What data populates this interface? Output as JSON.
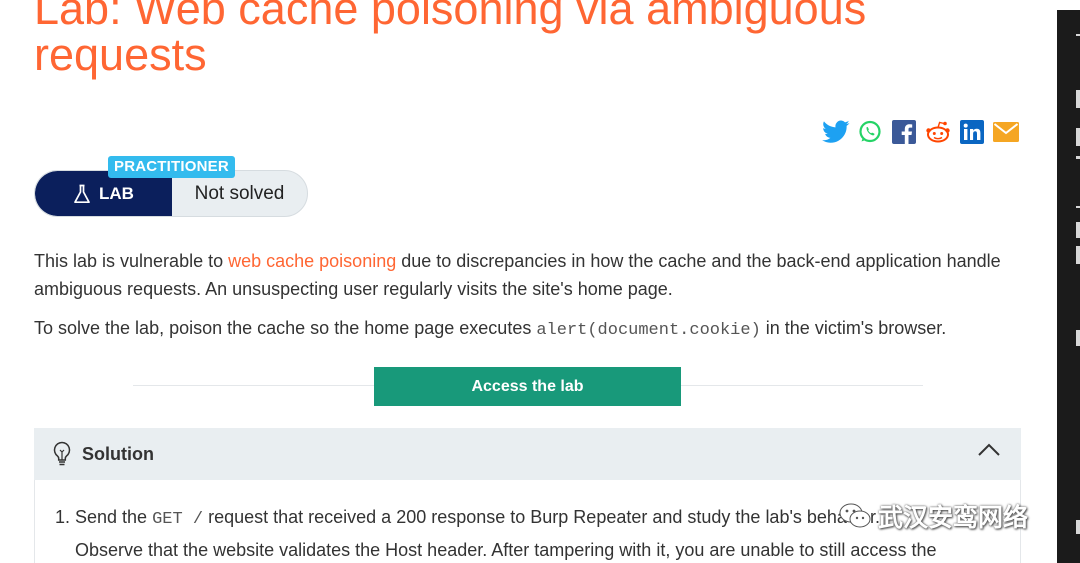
{
  "page": {
    "title_line1": "Lab: Web cache poisoning via ambiguous",
    "title_line2": "requests"
  },
  "share": {
    "icons": [
      "twitter-icon",
      "whatsapp-icon",
      "facebook-icon",
      "reddit-icon",
      "linkedin-icon",
      "email-icon"
    ],
    "colors": {
      "twitter": "#1da1f2",
      "whatsapp": "#25d366",
      "facebook": "#3b5998",
      "reddit": "#ff4500",
      "linkedin": "#0a66c2",
      "email": "#f5a623"
    }
  },
  "badge": {
    "level": "PRACTITIONER",
    "type": "LAB",
    "status": "Not solved"
  },
  "description": {
    "p1_before": "This lab is vulnerable to ",
    "p1_link": "web cache poisoning",
    "p1_after": " due to discrepancies in how the cache and the back-end application handle ambiguous requests. An unsuspecting user regularly visits the site's home page.",
    "p2_before": "To solve the lab, poison the cache so the home page executes ",
    "p2_code": "alert(document.cookie)",
    "p2_after": " in the victim's browser."
  },
  "access_button": "Access the lab",
  "solution": {
    "title": "Solution",
    "step_number": "1.",
    "step_before": "Send the ",
    "step_code": "GET /",
    "step_after": " request that received a 200 response to Burp Repeater and study the lab's behavior.",
    "step_line2": "Observe that the website validates the Host header. After tampering with it, you are unable to still access the"
  },
  "watermark": "武汉安鸾网络",
  "colors": {
    "accent": "#ff6633",
    "lab_dark": "#0b1f5c",
    "level_blue": "#33bbee",
    "access_green": "#18997a"
  }
}
